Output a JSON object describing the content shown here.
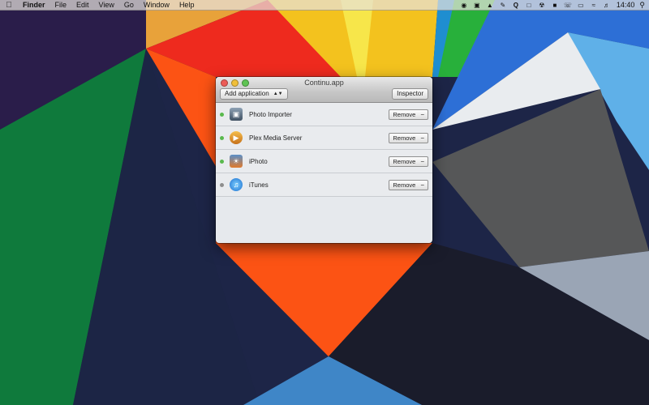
{
  "menubar": {
    "apple_icon": "apple-logo-icon",
    "app_name": "Finder",
    "menus": [
      "File",
      "Edit",
      "View",
      "Go",
      "Window",
      "Help"
    ],
    "status_icons": [
      "dropbox-icon",
      "box-icon",
      "cat-icon",
      "pen-icon",
      "q-icon",
      "dropbox-open-icon",
      "radiation-icon",
      "square-icon",
      "phone-icon",
      "airplay-icon",
      "wifi-icon",
      "volume-icon"
    ],
    "clock": "14:40",
    "spotlight_icon": "spotlight-search-icon"
  },
  "window": {
    "title": "Continu.app",
    "add_button": "Add application",
    "inspector_button": "Inspector",
    "rows": [
      {
        "name": "Photo Importer",
        "status": "active",
        "status_color": "#59b94d",
        "icon": "photo-importer-icon",
        "remove": "Remove"
      },
      {
        "name": "Plex Media Server",
        "status": "active",
        "status_color": "#59b94d",
        "icon": "plex-icon",
        "remove": "Remove"
      },
      {
        "name": "iPhoto",
        "status": "active",
        "status_color": "#59b94d",
        "icon": "iphoto-icon",
        "remove": "Remove"
      },
      {
        "name": "iTunes",
        "status": "inactive",
        "status_color": "#8e8e8e",
        "icon": "itunes-icon",
        "remove": "Remove"
      }
    ]
  }
}
